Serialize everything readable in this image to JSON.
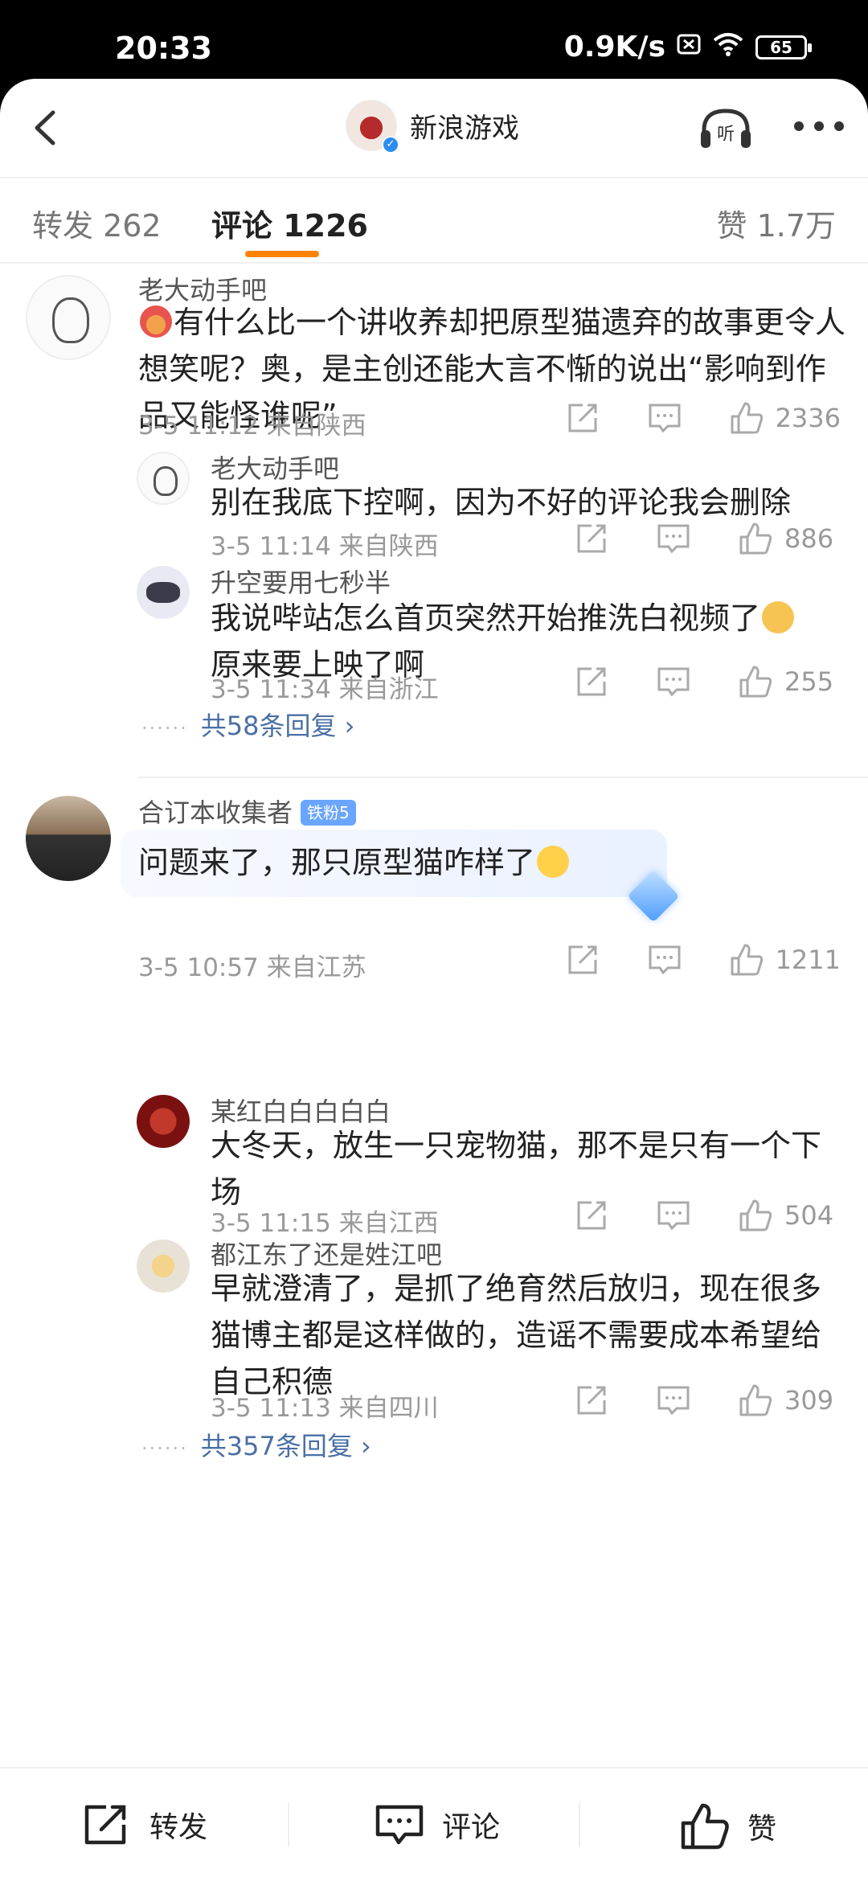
{
  "status_bar": {
    "time": "20:33",
    "network_speed": "0.9K/s",
    "battery": "65"
  },
  "nav": {
    "account_name": "新浪游戏"
  },
  "tabs": {
    "repost": "转发 262",
    "comments": "评论 1226",
    "likes": "赞 1.7万"
  },
  "comments": [
    {
      "user": "老大动手吧",
      "text": "有什么比一个讲收养却把原型猫遗弃的故事更令人想笑呢？奥，是主创还能大言不惭的说出“影响到作品又能怪谁呢”",
      "meta": "3-5 11:12  来自陕西",
      "likes": "2336",
      "replies": [
        {
          "user": "老大动手吧",
          "text": "别在我底下控啊，因为不好的评论我会删除",
          "meta": "3-5 11:14  来自陕西",
          "likes": "886"
        },
        {
          "user": "升空要用七秒半",
          "text": "我说哔站怎么首页突然开始推洗白视频了",
          "text2": "原来要上映了啊",
          "meta": "3-5 11:34  来自浙江",
          "likes": "255"
        }
      ],
      "more_replies": "共58条回复 ›"
    },
    {
      "user": "合订本收集者",
      "badge": "铁粉5",
      "text": "问题来了，那只原型猫咋样了",
      "meta": "3-5 10:57  来自江苏",
      "likes": "1211",
      "replies": [
        {
          "user": "某红白白白白白",
          "text": "大冬天，放生一只宠物猫，那不是只有一个下场",
          "meta": "3-5 11:15  来自江西",
          "likes": "504"
        },
        {
          "user": "都江东了还是姓江吧",
          "text": "早就澄清了，是抓了绝育然后放归，现在很多猫博主都是这样做的，造谣不需要成本希望给自己积德",
          "meta": "3-5 11:13  来自四川",
          "likes": "309"
        }
      ],
      "more_replies": "共357条回复 ›"
    }
  ],
  "bottom_bar": {
    "repost": "转发",
    "comment": "评论",
    "like": "赞"
  },
  "colors": {
    "accent": "#ff8200",
    "link": "#4a6fa5",
    "meta": "#999999"
  }
}
